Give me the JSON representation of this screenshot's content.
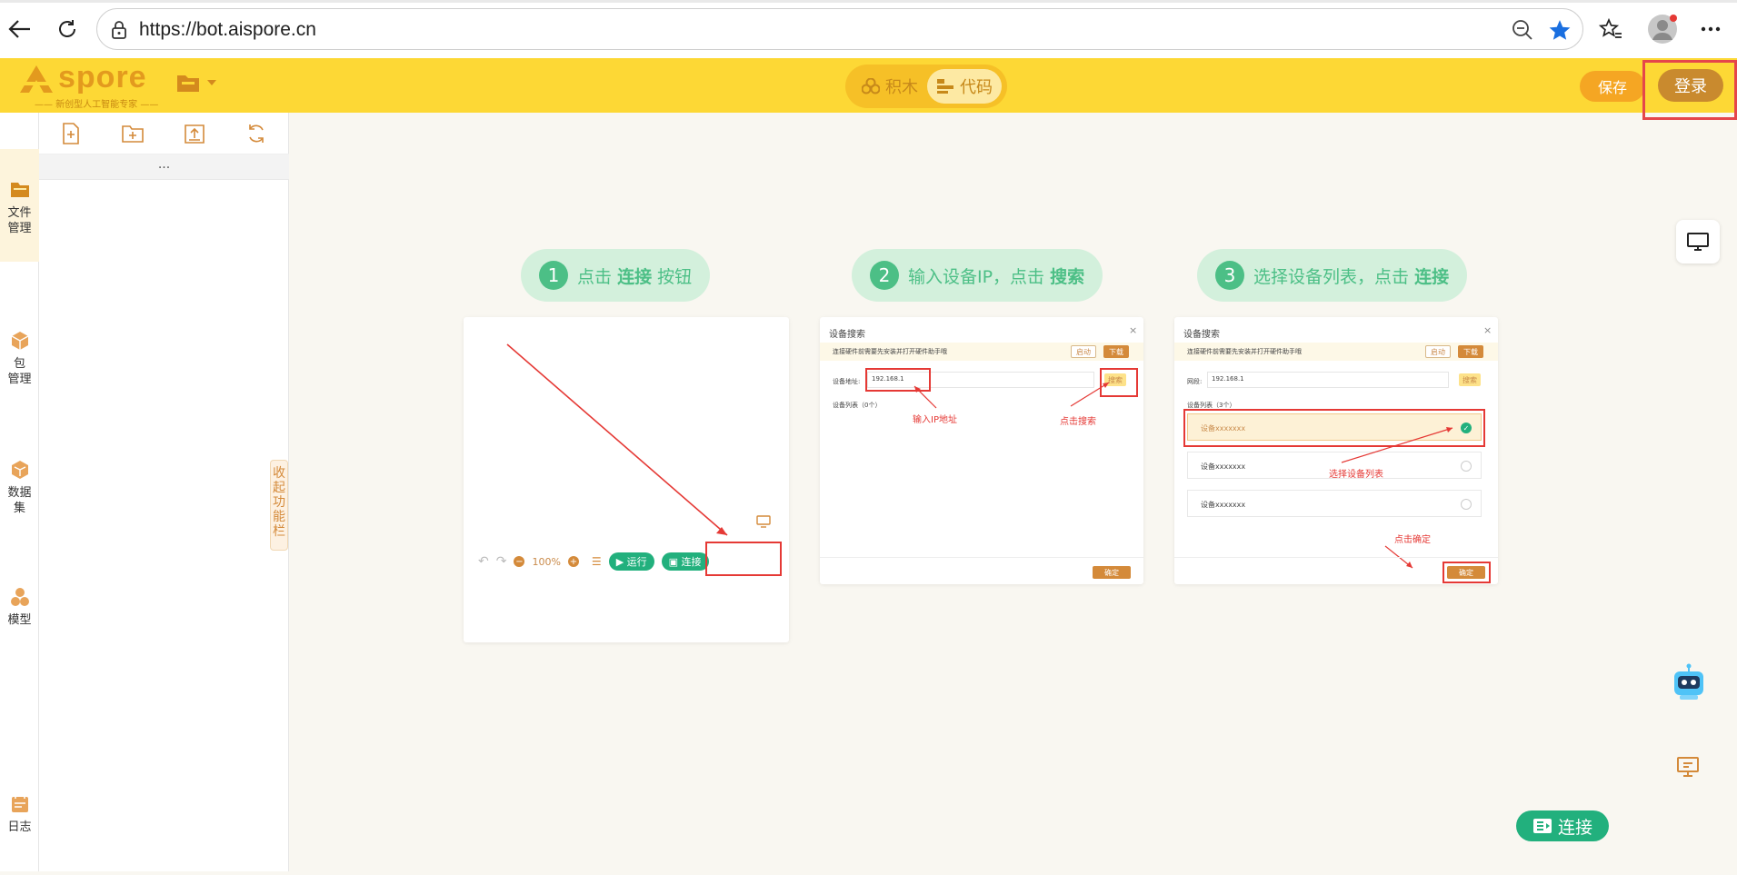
{
  "browser": {
    "url": "https://bot.aispore.cn",
    "icons": [
      "back-icon",
      "reload-icon",
      "lock-icon",
      "zoom-out-icon",
      "favorite-star-icon",
      "favorites-list-icon",
      "profile-avatar-icon",
      "more-menu-icon"
    ]
  },
  "header": {
    "logo_text": "spore",
    "logo_tagline": "—— 新创型人工智能专家 ——",
    "modes": [
      {
        "label": "积木",
        "active": false
      },
      {
        "label": "代码",
        "active": true
      }
    ],
    "save_label": "保存",
    "login_label": "登录",
    "accent": "#fdd835"
  },
  "sidebar": {
    "items": [
      {
        "label": "文件\n管理",
        "icon": "folder-icon",
        "active": true
      },
      {
        "label": "包\n管理",
        "icon": "package-icon",
        "active": false
      },
      {
        "label": "数据\n集",
        "icon": "dataset-icon",
        "active": false
      },
      {
        "label": "模型",
        "icon": "model-icon",
        "active": false
      },
      {
        "label": "日志",
        "icon": "log-icon",
        "active": false
      }
    ]
  },
  "file_panel": {
    "tools": [
      "new-file-icon",
      "new-folder-icon",
      "upload-icon",
      "refresh-icon"
    ],
    "path": "...",
    "collapse_label": "收起功能栏"
  },
  "guide": {
    "steps": [
      {
        "num": "1",
        "pre": "点击",
        "bold": "连接",
        "post": "按钮"
      },
      {
        "num": "2",
        "pre": "输入设备IP，点击",
        "bold": "搜索",
        "post": ""
      },
      {
        "num": "3",
        "pre": "选择设备列表，点击",
        "bold": "连接",
        "post": ""
      }
    ],
    "card1": {
      "zoom": "100%",
      "run_label": "运行",
      "connect_label": "连接"
    },
    "card2": {
      "title": "设备搜索",
      "notice": "连接硬件前需要先安装并打开硬件助手哦",
      "start_label": "启动",
      "download_label": "下载",
      "addr_label": "设备地址:",
      "addr_value": "192.168.1",
      "search_label": "搜索",
      "list_label": "设备列表（0个）",
      "ok_label": "确定",
      "hint_ip": "输入IP地址",
      "hint_search": "点击搜索"
    },
    "card3": {
      "title": "设备搜索",
      "notice": "连接硬件前需要先安装并打开硬件助手哦",
      "start_label": "启动",
      "download_label": "下载",
      "segment_label": "网段:",
      "segment_value": "192.168.1",
      "search_label": "搜索",
      "list_label": "设备列表（3个）",
      "devices": [
        "设备xxxxxxx",
        "设备xxxxxxx",
        "设备xxxxxxx"
      ],
      "hint_select": "选择设备列表",
      "hint_ok": "点击确定",
      "ok_label": "确定"
    }
  },
  "floating": {
    "connect_label": "连接"
  }
}
